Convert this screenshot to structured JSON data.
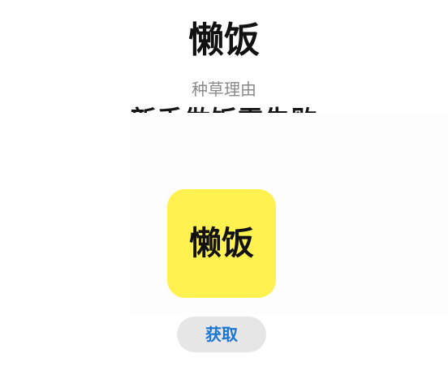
{
  "app": {
    "name": "懒饭"
  },
  "recommendation": {
    "label": "种草理由",
    "text": "新手做饭零失败"
  },
  "icon": {
    "text": "懒饭",
    "background_color": "#fff150"
  },
  "actions": {
    "get_label": "获取",
    "get_color": "#1976d2"
  }
}
